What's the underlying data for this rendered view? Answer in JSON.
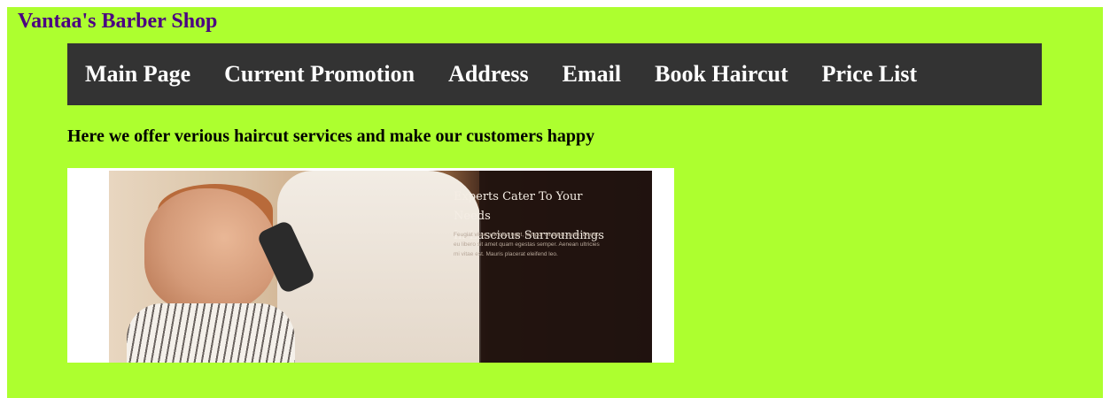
{
  "site": {
    "title": "Vantaa's Barber Shop"
  },
  "nav": {
    "items": [
      {
        "label": "Main Page"
      },
      {
        "label": "Current Promotion"
      },
      {
        "label": "Address"
      },
      {
        "label": "Email"
      },
      {
        "label": "Book Haircut"
      },
      {
        "label": "Price List"
      }
    ]
  },
  "main": {
    "tagline": "Here we offer verious haircut services and make our customers happy",
    "hero": {
      "heading_line1": "Experts Cater To Your Needs",
      "heading_line2": "In Luscious Surroundings",
      "body": "Feugiat vitae, ultricies eget, tempor sit amet, ante. Donec eu libero sit amet quam egestas semper. Aenean ultricies mi vitae est. Mauris placerat eleifend leo."
    }
  },
  "colors": {
    "page_background": "#adff2f",
    "title": "#4b0082",
    "nav_background": "#333333",
    "nav_text": "#ffffff"
  }
}
